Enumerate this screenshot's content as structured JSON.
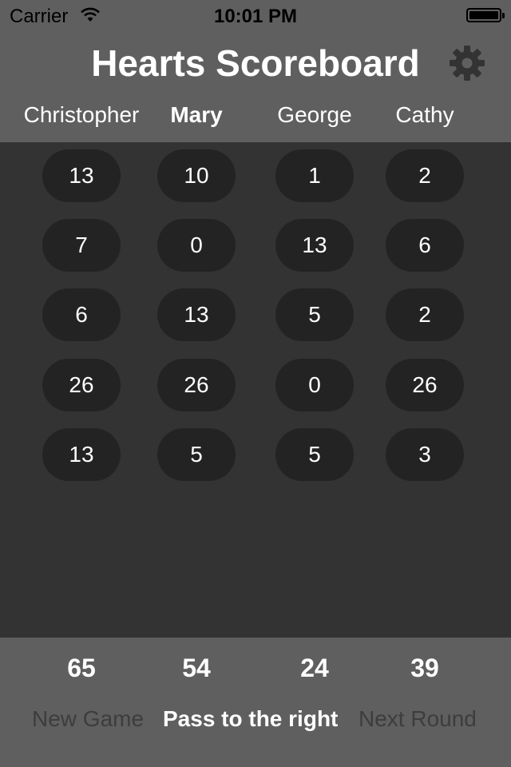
{
  "status_bar": {
    "carrier": "Carrier",
    "time": "10:01 PM"
  },
  "header": {
    "title": "Hearts Scoreboard"
  },
  "players": [
    {
      "name": "Christopher",
      "active": false
    },
    {
      "name": "Mary",
      "active": true
    },
    {
      "name": "George",
      "active": false
    },
    {
      "name": "Cathy",
      "active": false
    }
  ],
  "rounds": [
    [
      "13",
      "10",
      "1",
      "2"
    ],
    [
      "7",
      "0",
      "13",
      "6"
    ],
    [
      "6",
      "13",
      "5",
      "2"
    ],
    [
      "26",
      "26",
      "0",
      "26"
    ],
    [
      "13",
      "5",
      "5",
      "3"
    ]
  ],
  "totals": [
    "65",
    "54",
    "24",
    "39"
  ],
  "footer": {
    "new_game_label": "New Game",
    "pass_label": "Pass to the right",
    "next_round_label": "Next Round"
  },
  "colors": {
    "header_bg": "#5f5f5f",
    "body_bg": "#333333",
    "score_pill_bg": "#232323",
    "disabled_text": "#3d3d3d"
  }
}
